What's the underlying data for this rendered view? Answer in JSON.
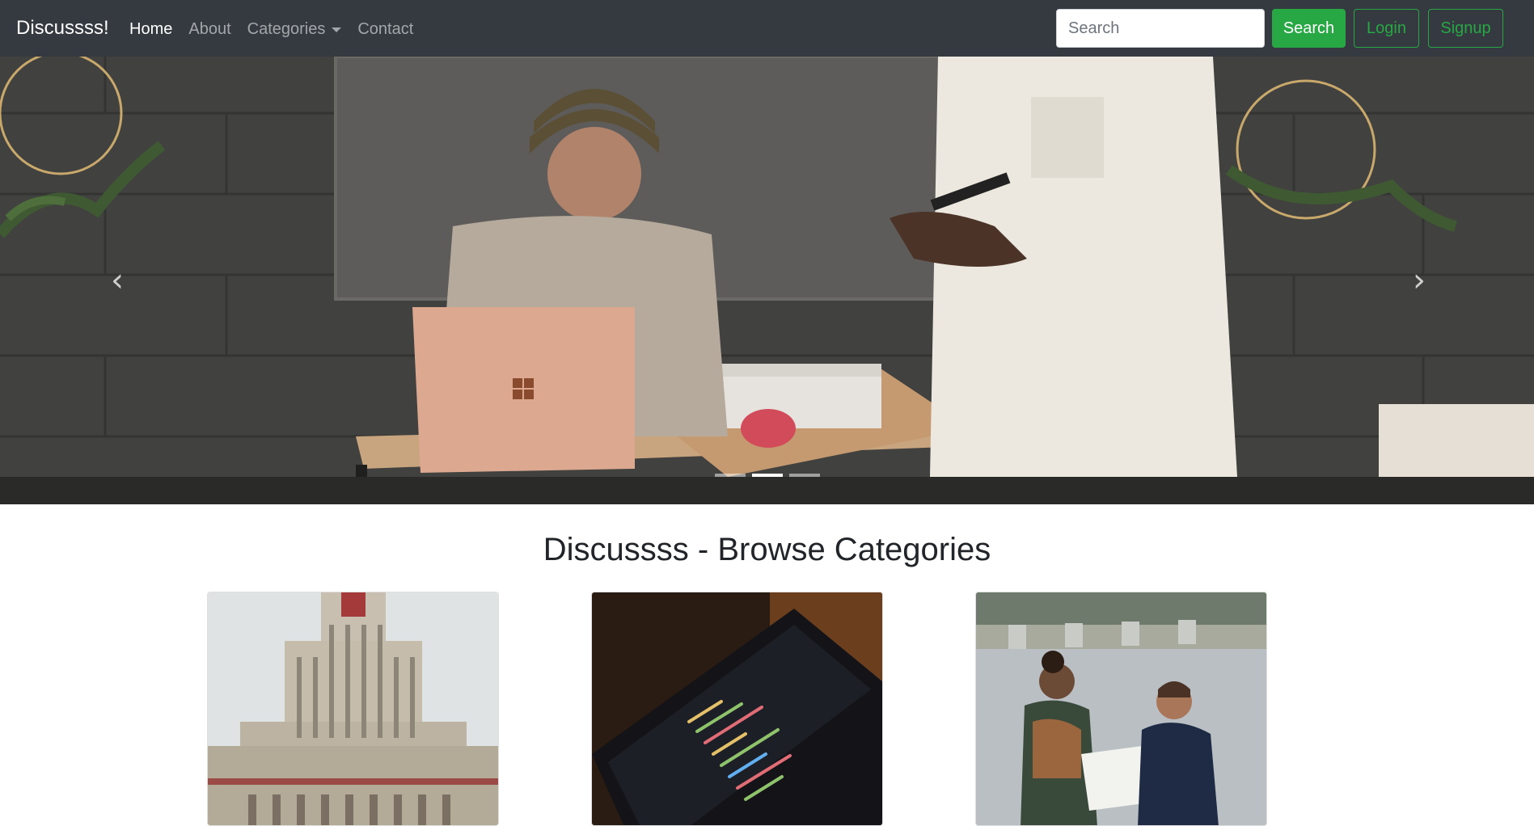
{
  "navbar": {
    "brand": "Discussss!",
    "links": [
      {
        "label": "Home",
        "active": true
      },
      {
        "label": "About",
        "active": false
      },
      {
        "label": "Categories",
        "active": false,
        "dropdown": true
      },
      {
        "label": "Contact",
        "active": false
      }
    ],
    "search": {
      "placeholder": "Search",
      "value": ""
    },
    "search_button": "Search",
    "login_button": "Login",
    "signup_button": "Signup"
  },
  "carousel": {
    "slide_count": 3,
    "active_index": 1,
    "prev_icon": "chevron-left-icon",
    "next_icon": "chevron-right-icon"
  },
  "main": {
    "title": "Discussss - Browse Categories",
    "cards": [
      {
        "image": "building-photo"
      },
      {
        "image": "code-laptop-photo"
      },
      {
        "image": "people-river-photo"
      }
    ]
  },
  "colors": {
    "navbar_bg": "#343a40",
    "success": "#28a745",
    "text": "#212529"
  }
}
